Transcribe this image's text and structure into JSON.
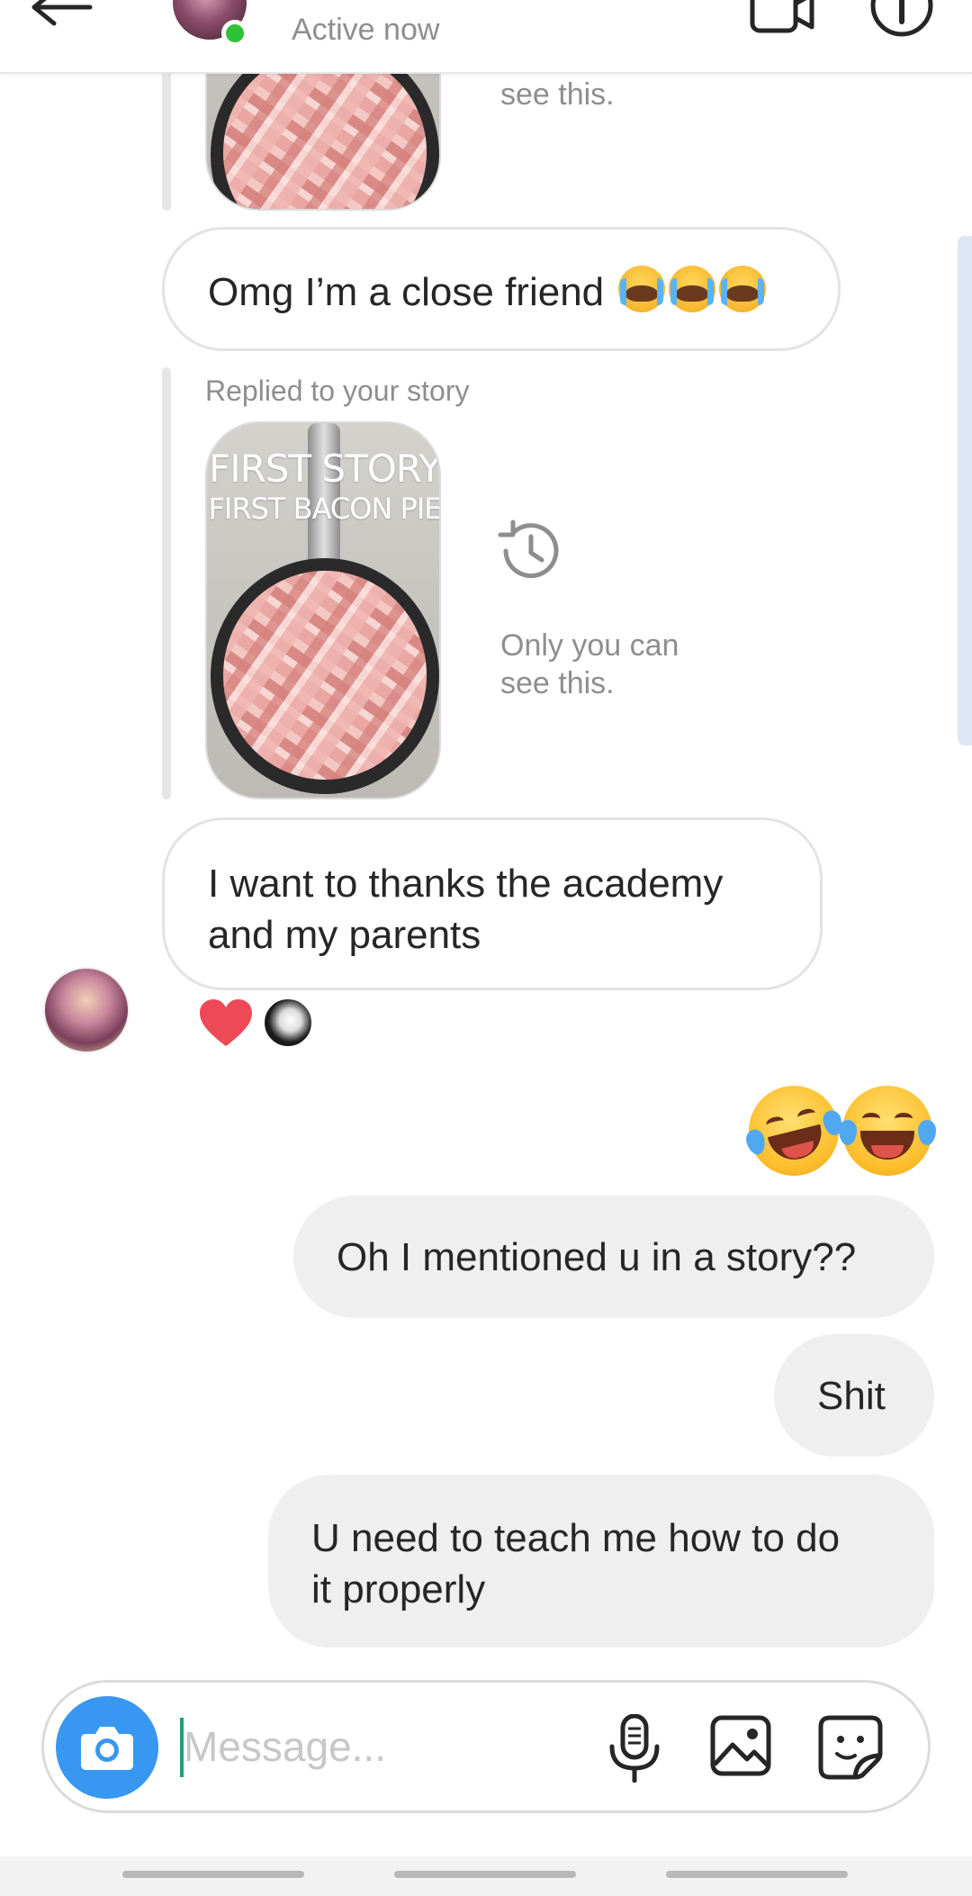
{
  "header": {
    "status": "Active now"
  },
  "messages": {
    "partial_only_you_line2": "see this.",
    "bubble_close_friend": "Omg I’m a close friend",
    "story_reply": {
      "label": "Replied to your story",
      "story_title_line1": "FIRST STORY",
      "story_title_line2": "FIRST BACON PIE",
      "only_you_line1": "Only you can",
      "only_you_line2": "see this."
    },
    "bubble_academy_line1": "I want to thanks the academy",
    "bubble_academy_line2": "and my parents",
    "out_mentioned": "Oh I mentioned u in a story??",
    "out_shit": "Shit",
    "out_teach_line1": "U need to teach me how to do",
    "out_teach_line2": "it properly"
  },
  "reactions": {
    "heart_color": "#ed4956"
  },
  "composer": {
    "placeholder": "Message...",
    "value": ""
  },
  "colors": {
    "accent": "#3897f0",
    "online": "#2ec236",
    "incoming_border": "#e3e3e3",
    "outgoing_bg": "#efefef"
  },
  "icons": {
    "back": "back-arrow-icon",
    "video": "video-call-icon",
    "info": "info-icon",
    "history": "history-icon",
    "camera": "camera-icon",
    "mic": "microphone-icon",
    "gallery": "gallery-icon",
    "sticker": "sticker-icon"
  }
}
